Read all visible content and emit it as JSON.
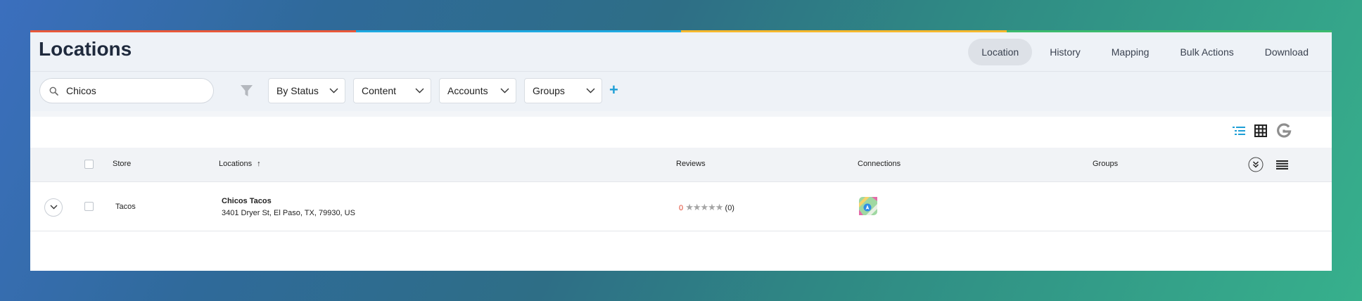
{
  "header": {
    "title": "Locations",
    "stripe_colors": [
      "#e8583a",
      "#1ea9e1",
      "#f5b82e",
      "#3cba6e"
    ],
    "nav": [
      {
        "label": "Location",
        "active": true
      },
      {
        "label": "History",
        "active": false
      },
      {
        "label": "Mapping",
        "active": false
      },
      {
        "label": "Bulk Actions",
        "active": false
      },
      {
        "label": "Download",
        "active": false
      }
    ]
  },
  "filters": {
    "search_value": "Chicos",
    "dropdowns": [
      {
        "label": "By Status"
      },
      {
        "label": "Content"
      },
      {
        "label": "Accounts"
      },
      {
        "label": "Groups"
      }
    ],
    "add_label": "+"
  },
  "view_toggles": [
    "list-view-icon",
    "grid-view-icon",
    "google-icon"
  ],
  "table": {
    "columns": [
      "Store",
      "Locations",
      "Reviews",
      "Connections",
      "Groups"
    ],
    "sort_indicator": "↑",
    "rows": [
      {
        "store": "Tacos",
        "name": "Chicos Tacos",
        "address": "3401 Dryer St, El Paso, TX, 79930, US",
        "review_score": "0",
        "stars": "★★★★★",
        "review_count": "(0)",
        "connection": "apple-maps-icon",
        "group": ""
      }
    ]
  },
  "colors": {
    "accent": "#1e9fd6",
    "review_score": "#e0432d",
    "title": "#1f2a3d"
  }
}
